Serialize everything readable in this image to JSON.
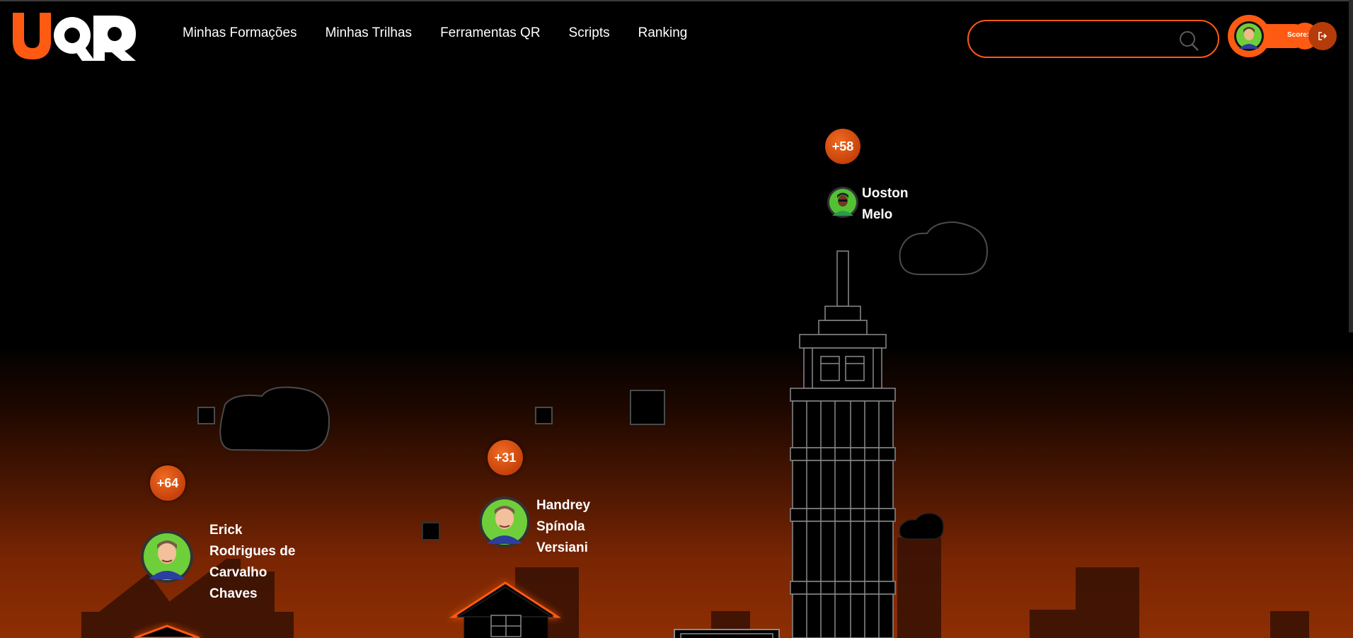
{
  "brand": {
    "logo_text": "UQR",
    "accent": "#ff5a12"
  },
  "nav": {
    "items": [
      {
        "label": "Minhas Formações"
      },
      {
        "label": "Minhas Trilhas"
      },
      {
        "label": "Ferramentas QR"
      },
      {
        "label": "Scripts"
      },
      {
        "label": "Ranking"
      }
    ]
  },
  "search": {
    "value": "",
    "placeholder": "",
    "icon": "search-icon"
  },
  "user": {
    "score_label": "Score:",
    "avatar_icon": "avatar-icon",
    "logout_icon": "logout-icon"
  },
  "ranking": [
    {
      "points": "+58",
      "name_lines": [
        "Uoston",
        "Melo"
      ]
    },
    {
      "points": "+31",
      "name_lines": [
        "Handrey",
        "Spínola",
        "Versiani"
      ]
    },
    {
      "points": "+64",
      "name_lines": [
        "Erick",
        "Rodrigues de",
        "Carvalho",
        "Chaves"
      ]
    }
  ]
}
